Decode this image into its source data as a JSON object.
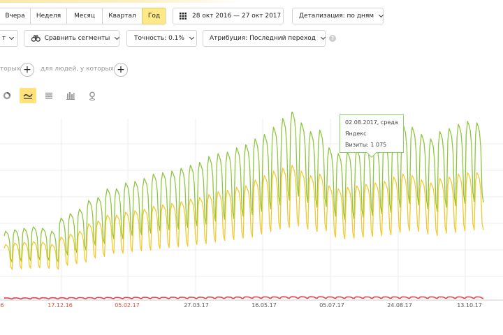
{
  "toolbar": {
    "periods": [
      "Вчера",
      "Неделя",
      "Месяц",
      "Квартал",
      "Год"
    ],
    "active_period": "Год",
    "date_range": "28 окт 2016 — 27 окт 2017",
    "detail_label": "Детализация: по дням",
    "compare_label": "Сравнить сегменты",
    "accuracy_label": "Точность: 0.1%",
    "attribution_label": "Атрибуция: Последний переход",
    "help_icon": "question-icon"
  },
  "segments": {
    "cut_label": "торых",
    "people_label": "для людей, у которых"
  },
  "views": [
    "pie-icon",
    "line-chart-icon",
    "area-chart-icon",
    "bar-chart-icon",
    "map-icon"
  ],
  "tooltip": {
    "date": "02.08.2017, среда",
    "source": "Яндекс",
    "visits": "Визиты: 1 075"
  },
  "colors": {
    "green": "#8ec63f",
    "yellow": "#f3c92f",
    "red": "#e5404a",
    "accent": "#ffe27a"
  },
  "chart_data": {
    "type": "line",
    "x_ticks": [
      "6",
      "17.12.16",
      "05.02.17",
      "27.03.17",
      "16.05.17",
      "05.07.17",
      "24.08.17",
      "13.10.17"
    ],
    "red_ticks": [
      "6",
      "17.12.16",
      "05.02.17"
    ],
    "series": [
      {
        "color": "#8ec63f",
        "week_peak": [
          470,
          480,
          490,
          500,
          490,
          470,
          560,
          590,
          620,
          680,
          700,
          760,
          760,
          800,
          810,
          830,
          860,
          870,
          880,
          900,
          920,
          940,
          980,
          1000,
          1010,
          1040,
          1060,
          1100,
          1130,
          1180,
          1240,
          1290,
          1210,
          1150,
          1160,
          1040,
          1000,
          1010,
          1030,
          1050,
          1070,
          1090,
          1150,
          1200,
          1180,
          1130,
          1100,
          1150,
          1170,
          1200,
          1220,
          1210
        ]
      },
      {
        "color": "#f3c92f",
        "week_peak": [
          380,
          390,
          395,
          400,
          395,
          380,
          430,
          450,
          470,
          520,
          540,
          580,
          580,
          600,
          610,
          620,
          640,
          650,
          660,
          670,
          690,
          700,
          720,
          740,
          750,
          770,
          780,
          820,
          850,
          880,
          900,
          920,
          880,
          850,
          860,
          780,
          760,
          770,
          780,
          790,
          800,
          810,
          840,
          860,
          850,
          820,
          800,
          830,
          840,
          860,
          870,
          870
        ]
      },
      {
        "color": "#e5404a",
        "week_peak": [
          15,
          15,
          15,
          16,
          16,
          16,
          16,
          17,
          17,
          17,
          18,
          18,
          18,
          18,
          19,
          19,
          19,
          19,
          20,
          20,
          20,
          20,
          21,
          21,
          21,
          21,
          22,
          22,
          22,
          22,
          23,
          23,
          23,
          23,
          23,
          22,
          22,
          22,
          22,
          22,
          22,
          22,
          22,
          22,
          22,
          22,
          22,
          22,
          22,
          22,
          22,
          22
        ]
      }
    ],
    "tooltip_point": {
      "date": "02.08.2017",
      "series": "Яндекс",
      "value": 1075
    }
  }
}
